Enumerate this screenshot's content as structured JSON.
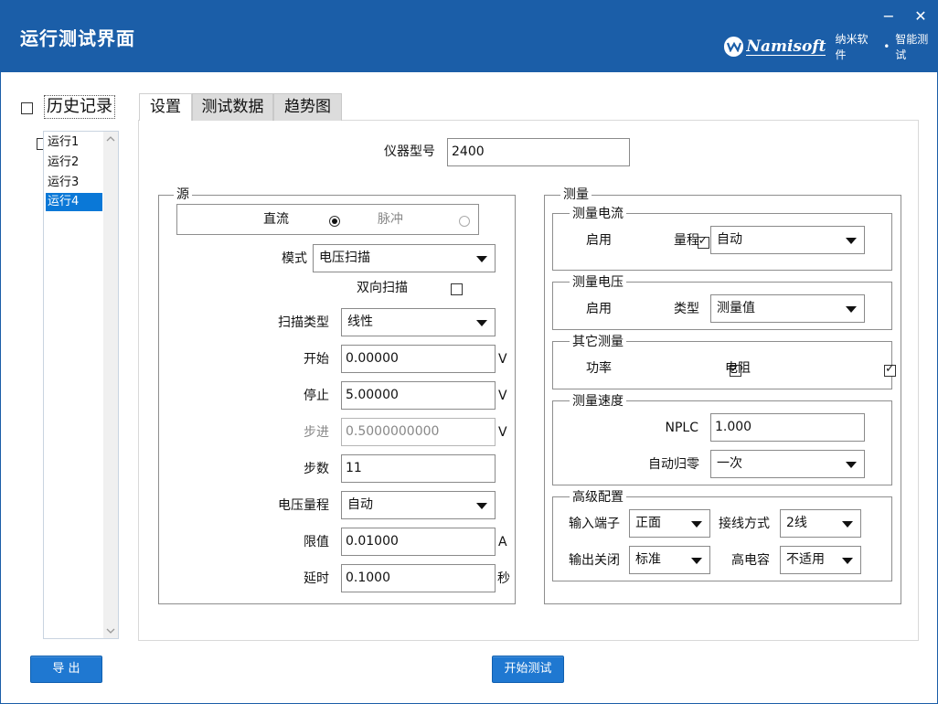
{
  "app": {
    "title": "运行测试界面",
    "minimize_glyph": "−",
    "close_glyph": "✕"
  },
  "brand": {
    "name": "Namisoft",
    "company": "纳米软件",
    "dot": "•",
    "product": "智能测试",
    "logo_icon": "namisoft-logo-icon"
  },
  "history": {
    "label": "历史记录",
    "checked": false,
    "items": [
      {
        "label": "运行1",
        "checked": false
      },
      {
        "label": "运行2",
        "checked": false
      },
      {
        "label": "运行3",
        "checked": false
      },
      {
        "label": "运行4",
        "checked": false,
        "selected": true
      }
    ]
  },
  "tabs": [
    {
      "label": "设置",
      "active": true
    },
    {
      "label": "测试数据",
      "active": false
    },
    {
      "label": "趋势图",
      "active": false
    }
  ],
  "instrument": {
    "label": "仪器型号",
    "value": "2400"
  },
  "source": {
    "title": "源",
    "dc_label": "直流",
    "pulse_label": "脉冲",
    "mode_label": "模式",
    "mode_value": "电压扫描",
    "bidirectional_label": "双向扫描",
    "sweep_type_label": "扫描类型",
    "sweep_type_value": "线性",
    "start_label": "开始",
    "start_value": "0.00000",
    "start_unit": "V",
    "stop_label": "停止",
    "stop_value": "5.00000",
    "stop_unit": "V",
    "step_label": "步进",
    "step_value": "0.5000000000",
    "step_unit": "V",
    "points_label": "步数",
    "points_value": "11",
    "range_label": "电压量程",
    "range_value": "自动",
    "limit_label": "限值",
    "limit_value": "0.01000",
    "limit_unit": "A",
    "delay_label": "延时",
    "delay_value": "0.1000",
    "delay_unit": "秒"
  },
  "measure": {
    "title": "测量",
    "current": {
      "title": "测量电流",
      "enable_label": "启用",
      "range_label": "量程",
      "range_value": "自动"
    },
    "voltage": {
      "title": "测量电压",
      "enable_label": "启用",
      "type_label": "类型",
      "type_value": "测量值"
    },
    "other": {
      "title": "其它测量",
      "power_label": "功率",
      "resistance_label": "电阻"
    },
    "speed": {
      "title": "测量速度",
      "nplc_label": "NPLC",
      "nplc_value": "1.000",
      "autozero_label": "自动归零",
      "autozero_value": "一次"
    },
    "advanced": {
      "title": "高级配置",
      "terminal_label": "输入端子",
      "terminal_value": "正面",
      "wiring_label": "接线方式",
      "wiring_value": "2线",
      "output_off_label": "输出关闭",
      "output_off_value": "标准",
      "high_cap_label": "高电容",
      "high_cap_value": "不适用"
    }
  },
  "buttons": {
    "export": "导 出",
    "start": "开始测试"
  },
  "colors": {
    "titlebar": "#1b5ea8",
    "accent": "#1f78d1",
    "selection": "#0a78d7"
  }
}
